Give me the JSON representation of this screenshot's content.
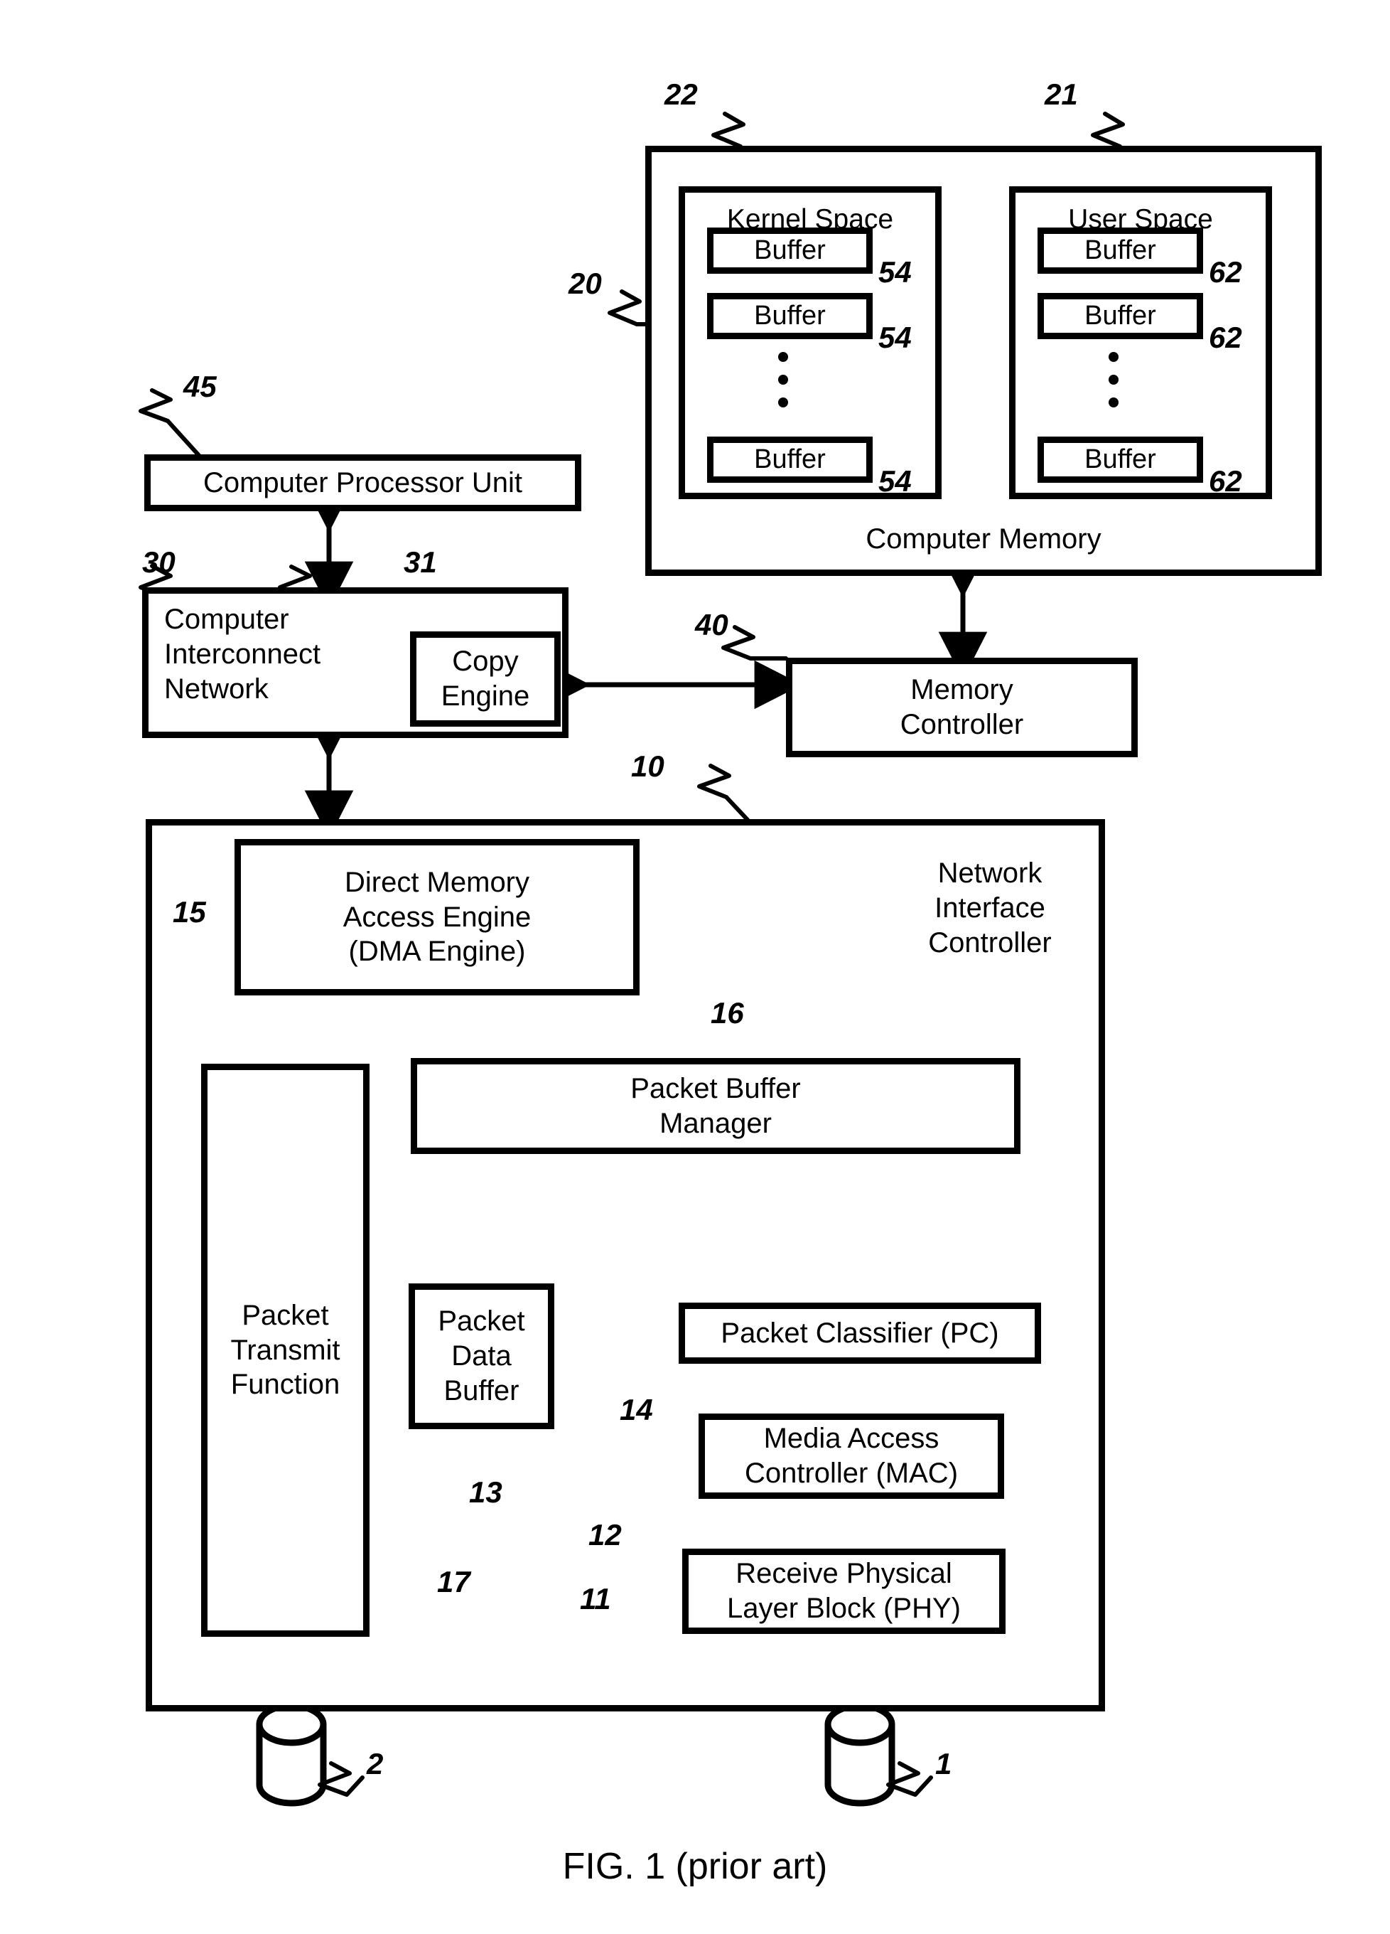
{
  "figure": {
    "caption": "FIG. 1 (prior art)"
  },
  "memory": {
    "title": "Computer Memory",
    "ref": "20",
    "kernel_space": {
      "title": "Kernel Space",
      "ref": "22",
      "buffers": [
        {
          "label": "Buffer",
          "ref": "54"
        },
        {
          "label": "Buffer",
          "ref": "54"
        },
        {
          "label": "Buffer",
          "ref": "54"
        }
      ]
    },
    "user_space": {
      "title": "User Space",
      "ref": "21",
      "buffers": [
        {
          "label": "Buffer",
          "ref": "62"
        },
        {
          "label": "Buffer",
          "ref": "62"
        },
        {
          "label": "Buffer",
          "ref": "62"
        }
      ]
    }
  },
  "cpu": {
    "label": "Computer Processor Unit",
    "ref": "45"
  },
  "interconnect": {
    "label": "Computer\nInterconnect\nNetwork",
    "ref": "30",
    "copy_engine": {
      "label": "Copy\nEngine",
      "ref": "31"
    }
  },
  "memory_controller": {
    "label": "Memory\nController",
    "ref": "40"
  },
  "nic": {
    "label": "Network\nInterface\nController",
    "ref": "10",
    "dma_engine": {
      "label": "Direct Memory\nAccess Engine\n(DMA Engine)",
      "ref": "15"
    },
    "packet_buffer_manager": {
      "label": "Packet Buffer\nManager",
      "ref": "16"
    },
    "packet_transmit_function": {
      "label": "Packet\nTransmit\nFunction",
      "ref": "17"
    },
    "packet_data_buffer": {
      "label": "Packet\nData\nBuffer",
      "ref": "13"
    },
    "packet_classifier": {
      "label": "Packet Classifier (PC)",
      "ref": "14"
    },
    "mac": {
      "label": "Media Access\nController (MAC)",
      "ref": "12"
    },
    "phy": {
      "label": "Receive Physical\nLayer Block (PHY)",
      "ref": "11"
    }
  },
  "ports": {
    "transmit": {
      "ref": "2"
    },
    "receive": {
      "ref": "1"
    }
  },
  "colors": {
    "ink": "#000000",
    "paper": "#ffffff"
  }
}
